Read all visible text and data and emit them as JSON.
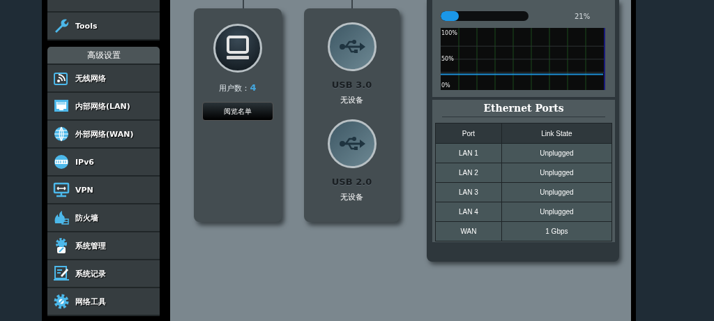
{
  "sidebar": {
    "items": [
      {
        "kind": "cut"
      },
      {
        "kind": "full",
        "label": "Tools"
      }
    ],
    "section_title": "高级设置",
    "advanced_items": [
      {
        "label": "无线网络"
      },
      {
        "label": "内部网络(LAN)"
      },
      {
        "label": "外部网络(WAN)"
      },
      {
        "label": "IPv6"
      },
      {
        "label": "VPN"
      },
      {
        "label": "防火墙"
      },
      {
        "label": "系统管理"
      },
      {
        "label": "系统记录"
      },
      {
        "label": "网络工具"
      }
    ]
  },
  "clients_card": {
    "label": "用户数：",
    "count": "4",
    "button": "阅览名单"
  },
  "usb_ports": [
    {
      "name": "USB 3.0",
      "status": "无设备"
    },
    {
      "name": "USB 2.0",
      "status": "无设备"
    }
  ],
  "memory": {
    "level": 0.21,
    "reading": "21%",
    "chart_data": {
      "type": "line",
      "grid": true,
      "ylim": [
        -9,
        110
      ],
      "yticks": [
        {
          "value": 100,
          "label": "100%"
        },
        {
          "value": 50,
          "label": "50%"
        },
        {
          "value": 0,
          "label": "0%"
        }
      ],
      "series": [
        {
          "color": "#1e8fd6",
          "values": [
            21,
            21,
            21,
            21,
            21,
            21,
            21,
            21,
            21,
            21
          ]
        }
      ]
    }
  },
  "ethernet": {
    "title": "Ethernet Ports",
    "columns": [
      "Port",
      "Link State"
    ],
    "rows": [
      [
        "LAN 1",
        "Unplugged"
      ],
      [
        "LAN 2",
        "Unplugged"
      ],
      [
        "LAN 3",
        "Unplugged"
      ],
      [
        "LAN 4",
        "Unplugged"
      ],
      [
        "WAN",
        "1 Gbps"
      ]
    ]
  }
}
